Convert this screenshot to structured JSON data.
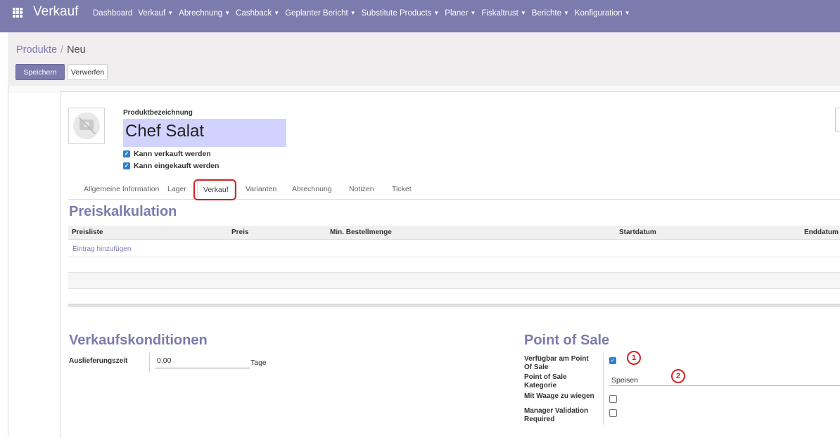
{
  "app": {
    "name": "Verkauf",
    "icon": "apps-grid-icon"
  },
  "menu": [
    {
      "label": "Dashboard",
      "dropdown": false
    },
    {
      "label": "Verkauf",
      "dropdown": true
    },
    {
      "label": "Abrechnung",
      "dropdown": true
    },
    {
      "label": "Cashback",
      "dropdown": true
    },
    {
      "label": "Geplanter Bericht",
      "dropdown": true
    },
    {
      "label": "Substitute Products",
      "dropdown": true
    },
    {
      "label": "Planer",
      "dropdown": true
    },
    {
      "label": "Fiskaltrust",
      "dropdown": true
    },
    {
      "label": "Berichte",
      "dropdown": true
    },
    {
      "label": "Konfiguration",
      "dropdown": true
    }
  ],
  "breadcrumb": {
    "parent": "Produkte",
    "separator": "/",
    "current": "Neu"
  },
  "buttons": {
    "save": "Speichern",
    "discard": "Verwerfen"
  },
  "product": {
    "name_label": "Produktbezeichnung",
    "name_value": "Chef Salat",
    "can_be_sold": "Kann verkauft werden",
    "can_be_purchased": "Kann eingekauft werden"
  },
  "tabs": [
    {
      "label": "Allgemeine Information",
      "active": false
    },
    {
      "label": "Lager",
      "active": false
    },
    {
      "label": "Verkauf",
      "active": true
    },
    {
      "label": "Varianten",
      "active": false
    },
    {
      "label": "Abrechnung",
      "active": false
    },
    {
      "label": "Notizen",
      "active": false
    },
    {
      "label": "Ticket",
      "active": false
    }
  ],
  "pricing": {
    "title": "Preiskalkulation",
    "columns": [
      "Preisliste",
      "Preis",
      "Min. Bestellmenge",
      "Startdatum",
      "Enddatum"
    ],
    "add_line": "Eintrag hinzufügen"
  },
  "sales_conditions": {
    "title": "Verkaufskonditionen",
    "lead_time_label": "Auslieferungszeit",
    "lead_time_value": "0,00",
    "lead_time_unit": "Tage"
  },
  "pos": {
    "title": "Point of Sale",
    "available_label_1": "Verfügbar am Point",
    "available_label_2": "Of Sale",
    "available_checked": true,
    "category_label_1": "Point of Sale",
    "category_label_2": "Kategorie",
    "category_value": "Speisen",
    "scale_label": "Mit Waage zu wiegen",
    "scale_checked": false,
    "manager_label_1": "Manager Validation",
    "manager_label_2": "Required",
    "manager_checked": false
  },
  "annotations": {
    "badge_1": "1",
    "badge_2": "2"
  },
  "colors": {
    "brand": "#7c7bad",
    "highlight": "#d62121",
    "name_field": "#d2d2ff",
    "checkbox": "#2d7dd2"
  }
}
